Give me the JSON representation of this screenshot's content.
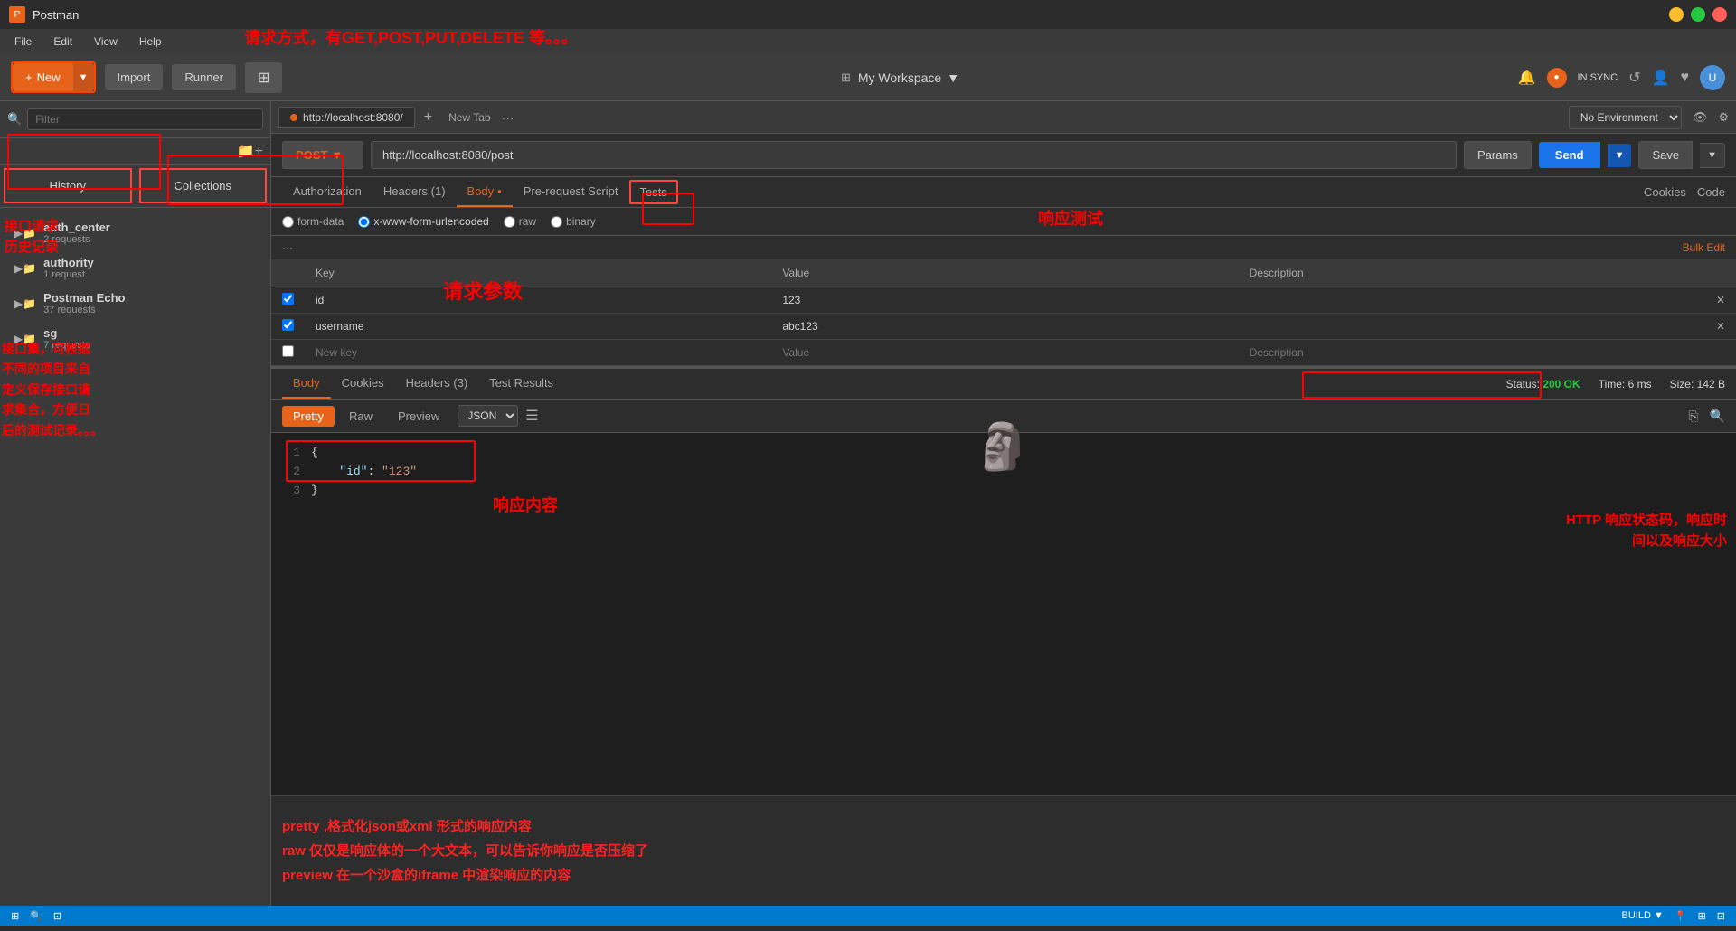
{
  "app": {
    "title": "Postman",
    "icon": "P"
  },
  "titlebar": {
    "minimize": "–",
    "maximize": "□",
    "close": "✕"
  },
  "menubar": {
    "items": [
      "File",
      "Edit",
      "View",
      "Help"
    ]
  },
  "toolbar": {
    "new_label": "New",
    "import_label": "Import",
    "runner_label": "Runner",
    "workspace_label": "My Workspace",
    "workspace_icon": "⊞",
    "sync_label": "IN SYNC",
    "build_label": "BUILD"
  },
  "sidebar": {
    "filter_placeholder": "Filter",
    "history_tab": "History",
    "collections_tab": "Collections",
    "new_collection_tooltip": "New Collection",
    "items": [
      {
        "name": "auth_center",
        "sub": "2 requests",
        "icon": "📁"
      },
      {
        "name": "authority",
        "sub": "1 request",
        "icon": "📁"
      },
      {
        "name": "Postman Echo",
        "sub": "37 requests",
        "icon": "📁"
      },
      {
        "name": "sg",
        "sub": "7 requests",
        "icon": "📁"
      }
    ]
  },
  "request": {
    "tab_label": "http://localhost:8080/",
    "method": "POST",
    "url": "http://localhost:8080/post",
    "tabs": {
      "authorization": "Authorization",
      "headers": "Headers (1)",
      "body": "Body",
      "pre_request": "Pre-request Script",
      "tests": "Tests"
    },
    "right_tabs": {
      "cookies": "Cookies",
      "code": "Code"
    },
    "body_options": [
      "form-data",
      "x-www-form-urlencoded",
      "raw",
      "binary"
    ],
    "body_active": "x-www-form-urlencoded",
    "params_table": {
      "headers": [
        "Key",
        "Value",
        "Description"
      ],
      "rows": [
        {
          "checked": true,
          "key": "id",
          "value": "123",
          "description": ""
        },
        {
          "checked": true,
          "key": "username",
          "value": "abc123",
          "description": ""
        }
      ],
      "new_row": {
        "key": "New key",
        "value": "Value",
        "description": "Description"
      },
      "bulk_edit": "Bulk Edit"
    },
    "params_btn": "Params",
    "send_btn": "Send",
    "save_btn": "Save"
  },
  "response": {
    "tabs": {
      "body": "Body",
      "cookies": "Cookies",
      "headers": "Headers (3)",
      "test_results": "Test Results"
    },
    "status": {
      "label": "Status:",
      "value": "200 OK",
      "time_label": "Time:",
      "time_value": "6 ms",
      "size_label": "Size:",
      "size_value": "142 B"
    },
    "view_tabs": [
      "Pretty",
      "Raw",
      "Preview"
    ],
    "active_view": "Pretty",
    "format": "JSON",
    "code": [
      {
        "line": 1,
        "text": "{"
      },
      {
        "line": 2,
        "text": "    \"id\": \"123\""
      },
      {
        "line": 3,
        "text": "}"
      }
    ]
  },
  "annotations": {
    "title": "请求方式，有GET,POST,PUT,DELETE 等。。。",
    "history_label": "接口请求\n历史记录",
    "collections_label": "接口集，可根据\n不同的项目来自\n定义保存接口请\n求集合，方便日\n后的测试记录。。。",
    "tests_label": "响应测试",
    "params_label": "请求参数",
    "response_label": "响应内容",
    "status_label": "HTTP 响应状态码，响应时\n间以及响应大小",
    "pretty_desc": "pretty ,格式化json或xml 形式的响应内容",
    "raw_desc": "raw 仅仅是响应体的一个大文本，可以告诉你响应是否压缩了",
    "preview_desc": "preview  在一个沙盒的iframe 中渲染响应的内容"
  },
  "statusbar": {
    "left_icons": [
      "⊞",
      "🔍",
      "⊡"
    ],
    "right_label": "BUILD ▼",
    "right_icons": [
      "📍",
      "⊞",
      "⊡"
    ]
  },
  "env": {
    "label": "No Environment",
    "eye_icon": "👁",
    "gear_icon": "⚙"
  }
}
